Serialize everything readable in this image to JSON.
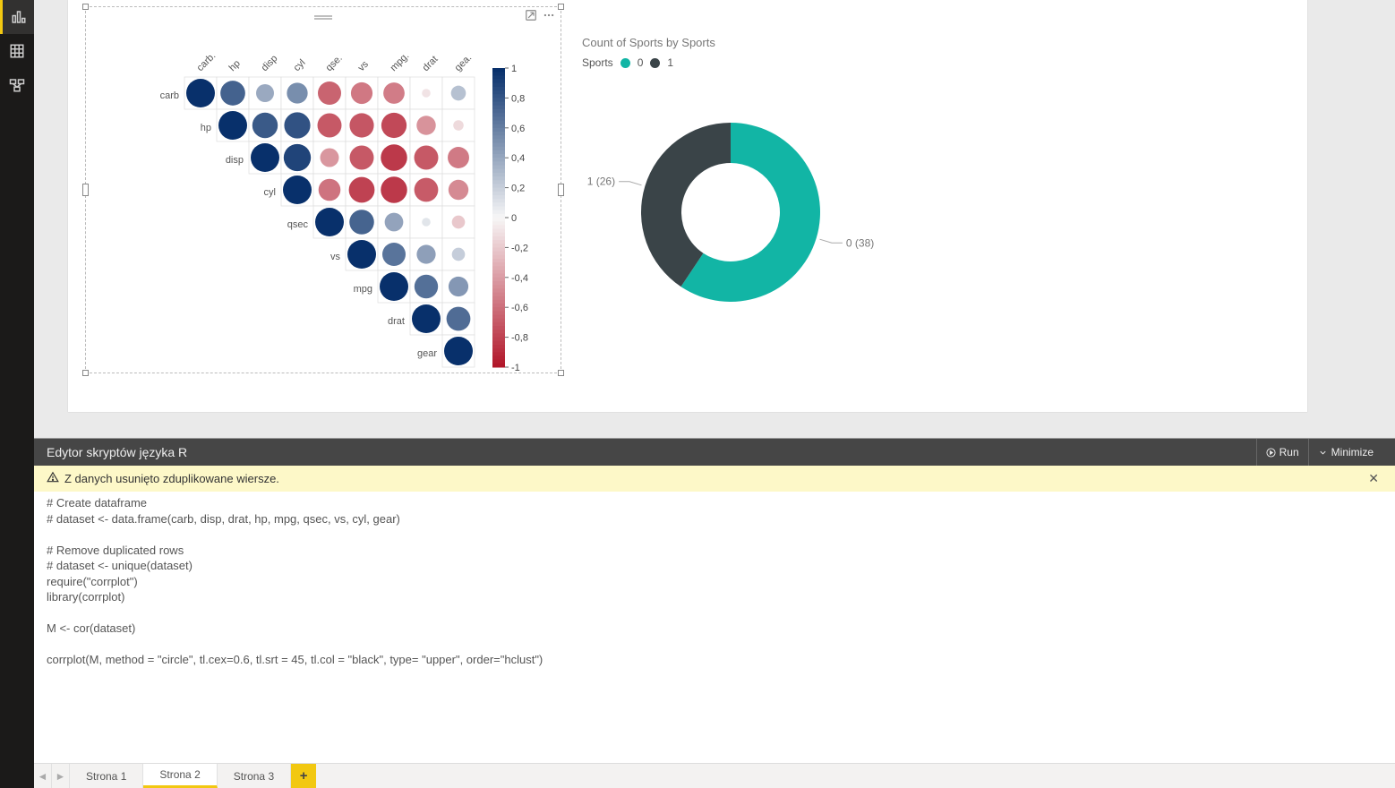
{
  "leftnav": {
    "items": [
      "report-view",
      "data-view",
      "model-view"
    ],
    "active": 0
  },
  "donut": {
    "title": "Count of Sports by Sports",
    "legend_title": "Sports",
    "series": [
      {
        "label": "0",
        "value": 38,
        "color": "#12b5a5",
        "data_label": "0 (38)"
      },
      {
        "label": "1",
        "value": 26,
        "color": "#3a4448",
        "data_label": "1 (26)"
      }
    ]
  },
  "chart_data": {
    "type": "heatmap",
    "title": "",
    "method": "correlation (upper triangle, circle)",
    "variables": [
      "carb",
      "hp",
      "disp",
      "cyl",
      "qsec",
      "vs",
      "mpg",
      "drat",
      "gear"
    ],
    "col_labels": [
      "carb.",
      "hp",
      "disp",
      "cyl",
      "qse.",
      "vs",
      "mpg.",
      "drat",
      "gea."
    ],
    "scale": {
      "min": -1,
      "max": 1,
      "ticks": [
        1,
        0.8,
        0.6,
        0.4,
        0.2,
        0,
        -0.2,
        -0.4,
        -0.6,
        -0.8,
        -1
      ]
    },
    "matrix": [
      [
        1.0,
        0.75,
        0.39,
        0.53,
        -0.66,
        -0.57,
        -0.55,
        -0.09,
        0.27
      ],
      [
        null,
        1.0,
        0.79,
        0.83,
        -0.71,
        -0.72,
        -0.78,
        -0.45,
        -0.13
      ],
      [
        null,
        null,
        1.0,
        0.9,
        -0.43,
        -0.71,
        -0.85,
        -0.71,
        -0.56
      ],
      [
        null,
        null,
        null,
        1.0,
        -0.59,
        -0.81,
        -0.85,
        -0.7,
        -0.49
      ],
      [
        null,
        null,
        null,
        null,
        1.0,
        0.74,
        0.42,
        0.09,
        -0.21
      ],
      [
        null,
        null,
        null,
        null,
        null,
        1.0,
        0.66,
        0.44,
        0.21
      ],
      [
        null,
        null,
        null,
        null,
        null,
        null,
        1.0,
        0.68,
        0.48
      ],
      [
        null,
        null,
        null,
        null,
        null,
        null,
        null,
        1.0,
        0.7
      ],
      [
        null,
        null,
        null,
        null,
        null,
        null,
        null,
        null,
        1.0
      ]
    ]
  },
  "script_panel": {
    "title": "Edytor skryptów języka R",
    "run_label": "Run",
    "minimize_label": "Minimize",
    "warning_text": "Z danych usunięto zduplikowane wiersze.",
    "code": "# Create dataframe\n# dataset <- data.frame(carb, disp, drat, hp, mpg, qsec, vs, cyl, gear)\n\n# Remove duplicated rows\n# dataset <- unique(dataset)\nrequire(\"corrplot\")\nlibrary(corrplot)\n\nM <- cor(dataset)\n\ncorrplot(M, method = \"circle\", tl.cex=0.6, tl.srt = 45, tl.col = \"black\", type= \"upper\", order=\"hclust\")"
  },
  "pages": {
    "items": [
      "Strona 1",
      "Strona 2",
      "Strona 3"
    ],
    "active": 1
  }
}
